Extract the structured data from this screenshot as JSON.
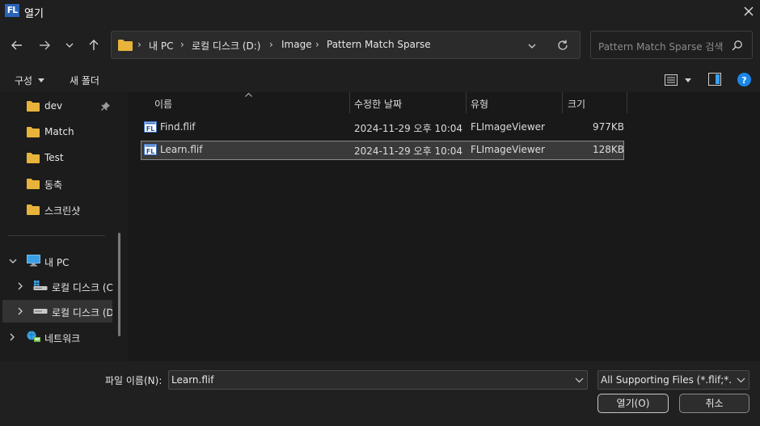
{
  "window": {
    "title": "열기",
    "app_icon_text": "FL"
  },
  "address": {
    "breadcrumbs": [
      "내 PC",
      "로컬 디스크 (D:)",
      "Image",
      "Pattern Match Sparse"
    ]
  },
  "search": {
    "placeholder": "Pattern Match Sparse 검색"
  },
  "commandbar": {
    "organize_label": "구성",
    "new_folder_label": "새 폴더"
  },
  "navpane": {
    "quick_items": [
      {
        "label": "dev",
        "pinned": true
      },
      {
        "label": "Match"
      },
      {
        "label": "Test"
      },
      {
        "label": "동축"
      },
      {
        "label": "스크린샷"
      }
    ],
    "this_pc": "내 PC",
    "drives": [
      {
        "label": "로컬 디스크 (C"
      },
      {
        "label": "로컬 디스크 (D"
      }
    ],
    "network": "네트워크"
  },
  "filelist": {
    "columns": [
      "이름",
      "수정한 날짜",
      "유형",
      "크기"
    ],
    "rows": [
      {
        "name": "Find.flif",
        "modified": "2024-11-29 오후 10:04",
        "type": "FLImageViewer",
        "size": "977KB"
      },
      {
        "name": "Learn.flif",
        "modified": "2024-11-29 오후 10:04",
        "type": "FLImageViewer",
        "size": "128KB"
      }
    ]
  },
  "footer": {
    "filename_label": "파일 이름(N):",
    "filename_value": "Learn.flif",
    "filetype_value": "All Supporting Files (*.flif;*.bm",
    "open_label": "열기(O)",
    "cancel_label": "취소"
  },
  "colors": {
    "folder": "#e8b33a",
    "accent": "#2a64b8",
    "help": "#1a86e8"
  }
}
